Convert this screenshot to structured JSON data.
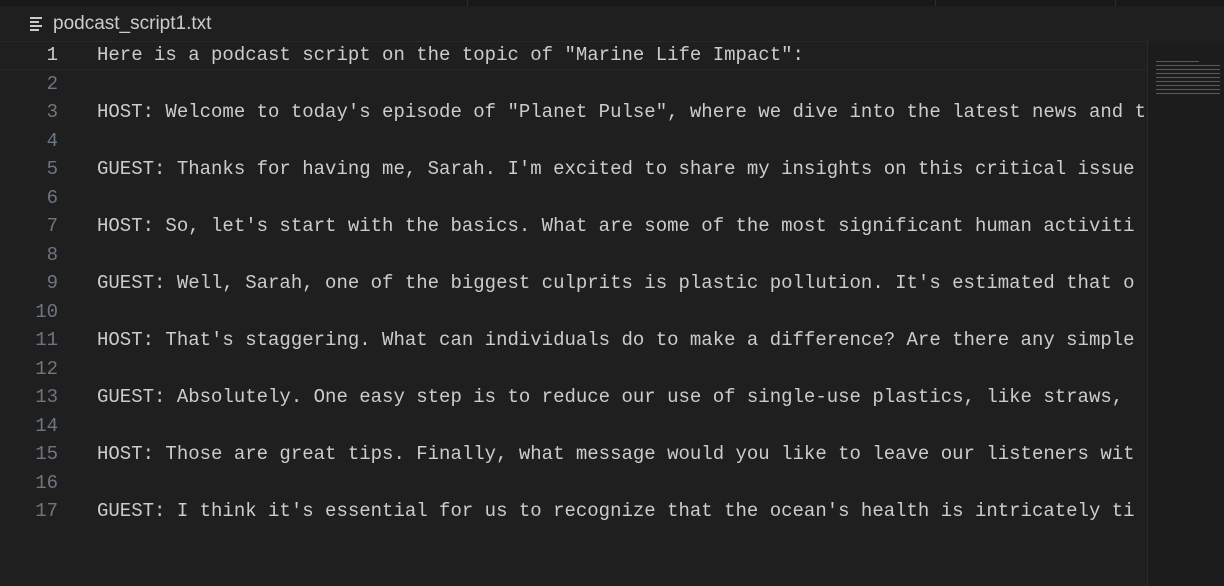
{
  "breadcrumb": {
    "icon": "text-file-lines-icon",
    "filename": "podcast_script1.txt"
  },
  "editor": {
    "current_line": 1,
    "lines": [
      {
        "number": "1",
        "text": "Here is a podcast script on the topic of \"Marine Life Impact\":"
      },
      {
        "number": "2",
        "text": ""
      },
      {
        "number": "3",
        "text": "HOST: Welcome to today's episode of \"Planet Pulse\", where we dive into the latest news and t"
      },
      {
        "number": "4",
        "text": ""
      },
      {
        "number": "5",
        "text": "GUEST: Thanks for having me, Sarah. I'm excited to share my insights on this critical issue"
      },
      {
        "number": "6",
        "text": ""
      },
      {
        "number": "7",
        "text": "HOST: So, let's start with the basics. What are some of the most significant human activiti"
      },
      {
        "number": "8",
        "text": ""
      },
      {
        "number": "9",
        "text": "GUEST: Well, Sarah, one of the biggest culprits is plastic pollution. It's estimated that o"
      },
      {
        "number": "10",
        "text": ""
      },
      {
        "number": "11",
        "text": "HOST: That's staggering. What can individuals do to make a difference? Are there any simple"
      },
      {
        "number": "12",
        "text": ""
      },
      {
        "number": "13",
        "text": "GUEST: Absolutely. One easy step is to reduce our use of single-use plastics, like straws, "
      },
      {
        "number": "14",
        "text": ""
      },
      {
        "number": "15",
        "text": "HOST: Those are great tips. Finally, what message would you like to leave our listeners wit"
      },
      {
        "number": "16",
        "text": ""
      },
      {
        "number": "17",
        "text": "GUEST: I think it's essential for us to recognize that the ocean's health is intricately ti"
      }
    ]
  }
}
